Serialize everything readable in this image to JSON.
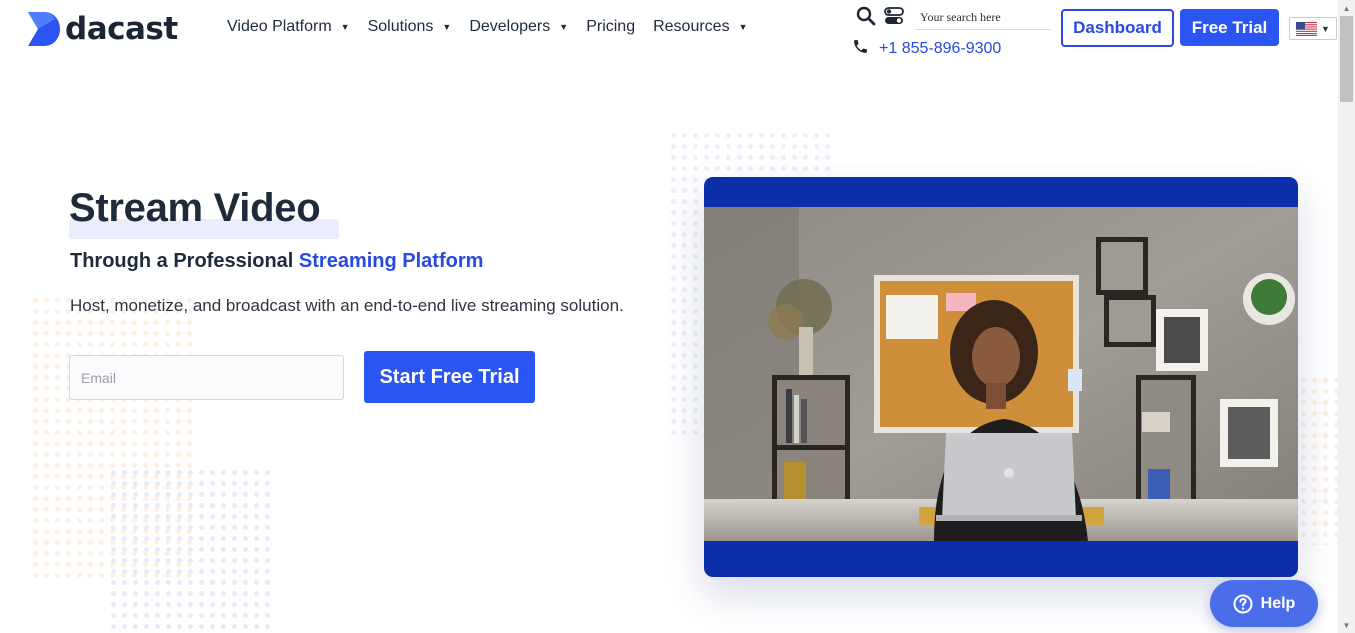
{
  "brand": {
    "name": "dacast"
  },
  "nav": {
    "items": [
      {
        "label": "Video Platform",
        "has_dropdown": true
      },
      {
        "label": "Solutions",
        "has_dropdown": true
      },
      {
        "label": "Developers",
        "has_dropdown": true
      },
      {
        "label": "Pricing",
        "has_dropdown": false
      },
      {
        "label": "Resources",
        "has_dropdown": true
      }
    ]
  },
  "header": {
    "search_placeholder": "Your search here",
    "phone": "+1 855-896-9300",
    "dashboard_label": "Dashboard",
    "free_trial_label": "Free Trial",
    "language": "US flag",
    "icons": [
      "search-icon",
      "toggle-icon",
      "phone-icon",
      "chevron-down-icon"
    ]
  },
  "hero": {
    "title": "Stream Video",
    "subtitle_prefix": "Through a Professional ",
    "subtitle_accent": "Streaming Platform",
    "description": "Host, monetize, and broadcast with an end-to-end live streaming solution.",
    "email_placeholder": "Email",
    "cta_label": "Start Free Trial"
  },
  "help": {
    "label": "Help"
  },
  "colors": {
    "brand_blue": "#2a55f2",
    "link_blue": "#2849e5",
    "video_border": "#0b2fa8",
    "help_blue": "#4a6de8",
    "text_dark": "#1f2a3a"
  }
}
